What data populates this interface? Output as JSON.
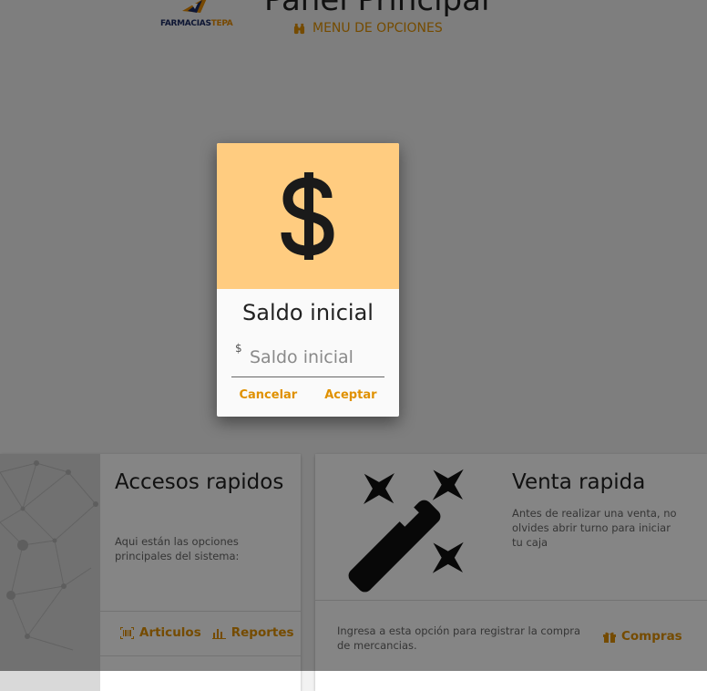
{
  "header": {
    "logo_text_a": "FARMACIAS",
    "logo_text_b": "TEPA",
    "title": "Panel Principal",
    "menu_label": "MENU DE OPCIONES",
    "menu_icon": "binoculars-icon"
  },
  "quick_access": {
    "title": "Accesos rapidos",
    "description": "Aqui están las opciones principales del sistema:",
    "actions": [
      {
        "label": "Articulos",
        "icon": "barcode-scan-icon"
      },
      {
        "label": "Reportes",
        "icon": "bar-chart-icon"
      }
    ]
  },
  "quick_sale": {
    "title": "Venta rapida",
    "description": "Antes de realizar una venta, no olvides abrir turno para iniciar tu caja",
    "footer_text": "Ingresa a esta opción para registrar la compra de mercancias.",
    "purchase_label": "Compras",
    "purchase_icon": "gift-icon"
  },
  "dialog": {
    "icon": "dollar-sign-icon",
    "title": "Saldo inicial",
    "input_prefix": "$",
    "input_placeholder": "Saldo inicial",
    "input_value": "",
    "cancel_label": "Cancelar",
    "accept_label": "Aceptar"
  },
  "colors": {
    "accent": "#e09100",
    "dialog_header": "#ffcc80",
    "logo_blue": "#1b2b63"
  }
}
